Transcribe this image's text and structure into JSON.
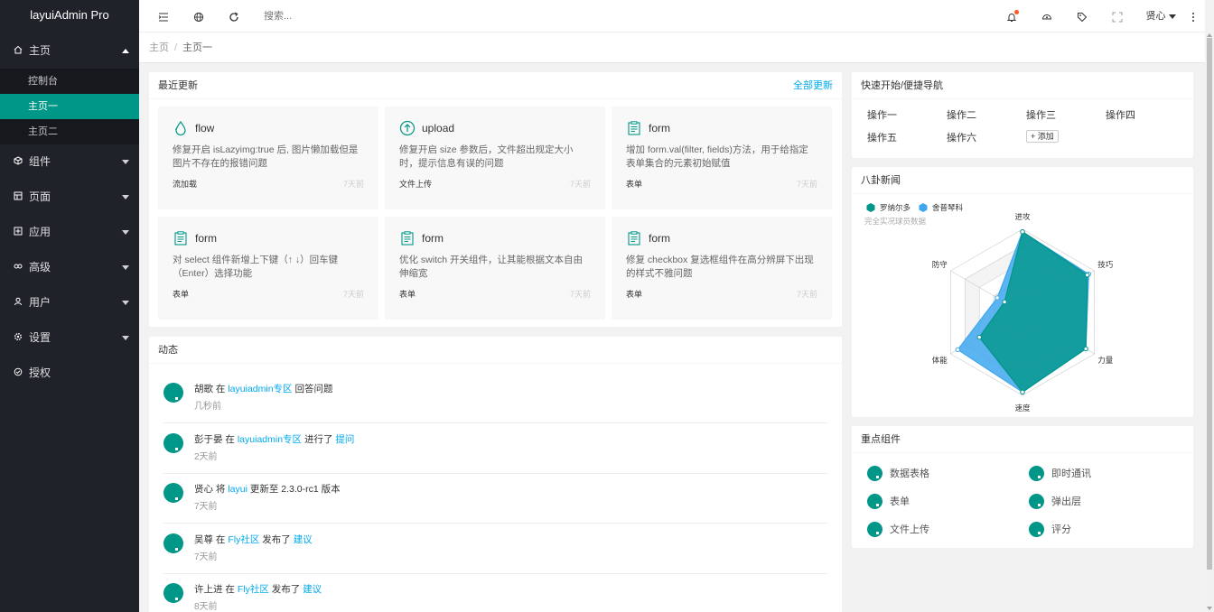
{
  "app": {
    "title": "layuiAdmin Pro"
  },
  "sidebar": {
    "items": [
      {
        "label": "主页",
        "icon": "home-icon",
        "expanded": true
      },
      {
        "label": "组件",
        "icon": "cube-icon"
      },
      {
        "label": "页面",
        "icon": "template-icon"
      },
      {
        "label": "应用",
        "icon": "app-icon"
      },
      {
        "label": "高级",
        "icon": "link-icon"
      },
      {
        "label": "用户",
        "icon": "user-icon"
      },
      {
        "label": "设置",
        "icon": "gear-icon"
      },
      {
        "label": "授权",
        "icon": "auth-icon"
      }
    ],
    "home_sub": [
      "控制台",
      "主页一",
      "主页二"
    ],
    "active_sub": "主页一"
  },
  "header": {
    "search_placeholder": "搜索...",
    "user": "贤心"
  },
  "breadcrumb": {
    "items": [
      "主页",
      "主页一"
    ]
  },
  "recent": {
    "title": "最近更新",
    "all_link": "全部更新",
    "items": [
      {
        "icon": "drop-icon",
        "title": "flow",
        "desc": "修复开启 isLazyimg:true 后, 图片懒加载但是图片不存在的报错问题",
        "tag": "流加载",
        "time": "7天前"
      },
      {
        "icon": "upload-icon",
        "title": "upload",
        "desc": "修复开启 size 参数后，文件超出规定大小时，提示信息有误的问题",
        "tag": "文件上传",
        "time": "7天前"
      },
      {
        "icon": "form-icon",
        "title": "form",
        "desc": "增加 form.val(filter, fields)方法，用于给指定表单集合的元素初始赋值",
        "tag": "表单",
        "time": "7天前"
      },
      {
        "icon": "form-icon",
        "title": "form",
        "desc": "对 select 组件新增上下键（↑ ↓）回车键（Enter）选择功能",
        "tag": "表单",
        "time": "7天前"
      },
      {
        "icon": "form-icon",
        "title": "form",
        "desc": "优化 switch 开关组件，让其能根据文本自由伸缩宽",
        "tag": "表单",
        "time": "7天前"
      },
      {
        "icon": "form-icon",
        "title": "form",
        "desc": "修复 checkbox 复选框组件在高分辨屏下出现的样式不雅问题",
        "tag": "表单",
        "time": "7天前"
      }
    ]
  },
  "activity": {
    "title": "动态",
    "items": [
      {
        "parts": [
          {
            "t": "胡歌 在 "
          },
          {
            "t": "layuiadmin专区",
            "link": true
          },
          {
            "t": " 回答问题"
          }
        ],
        "time": "几秒前"
      },
      {
        "parts": [
          {
            "t": "彭于晏 在 "
          },
          {
            "t": "layuiadmin专区",
            "link": true
          },
          {
            "t": " 进行了 "
          },
          {
            "t": "提问",
            "link": true
          }
        ],
        "time": "2天前"
      },
      {
        "parts": [
          {
            "t": "贤心 将 "
          },
          {
            "t": "layui",
            "link": true
          },
          {
            "t": " 更新至 2.3.0-rc1 版本"
          }
        ],
        "time": "7天前"
      },
      {
        "parts": [
          {
            "t": "吴尊 在 "
          },
          {
            "t": "Fly社区",
            "link": true
          },
          {
            "t": " 发布了 "
          },
          {
            "t": "建议",
            "link": true
          }
        ],
        "time": "7天前"
      },
      {
        "parts": [
          {
            "t": "许上进 在 "
          },
          {
            "t": "Fly社区",
            "link": true
          },
          {
            "t": " 发布了 "
          },
          {
            "t": "建议",
            "link": true
          }
        ],
        "time": "8天前"
      }
    ]
  },
  "quick": {
    "title": "快速开始/便捷导航",
    "items": [
      "操作一",
      "操作二",
      "操作三",
      "操作四",
      "操作五",
      "操作六"
    ],
    "add_label": "+ 添加"
  },
  "news": {
    "title": "八卦新闻",
    "subtitle": "完全实况球员数据",
    "chart_data": {
      "type": "radar",
      "indicators": [
        "进攻",
        "技巧",
        "力量",
        "速度",
        "体能",
        "防守"
      ],
      "max": 100,
      "series": [
        {
          "name": "罗纳尔多",
          "color": "#009688",
          "values": [
            97,
            90,
            88,
            96,
            60,
            25
          ]
        },
        {
          "name": "舍普琴科",
          "color": "#3fa7ee",
          "values": [
            97,
            92,
            88,
            96,
            90,
            35
          ]
        }
      ],
      "legend": "top-left",
      "grid_color": "#cccccc"
    }
  },
  "key_components": {
    "title": "重点组件",
    "items": [
      "数据表格",
      "即时通讯",
      "表单",
      "弹出层",
      "文件上传",
      "评分"
    ]
  },
  "colors": {
    "accent": "#009688",
    "link": "#01AAED",
    "sidebar": "#20222a"
  }
}
